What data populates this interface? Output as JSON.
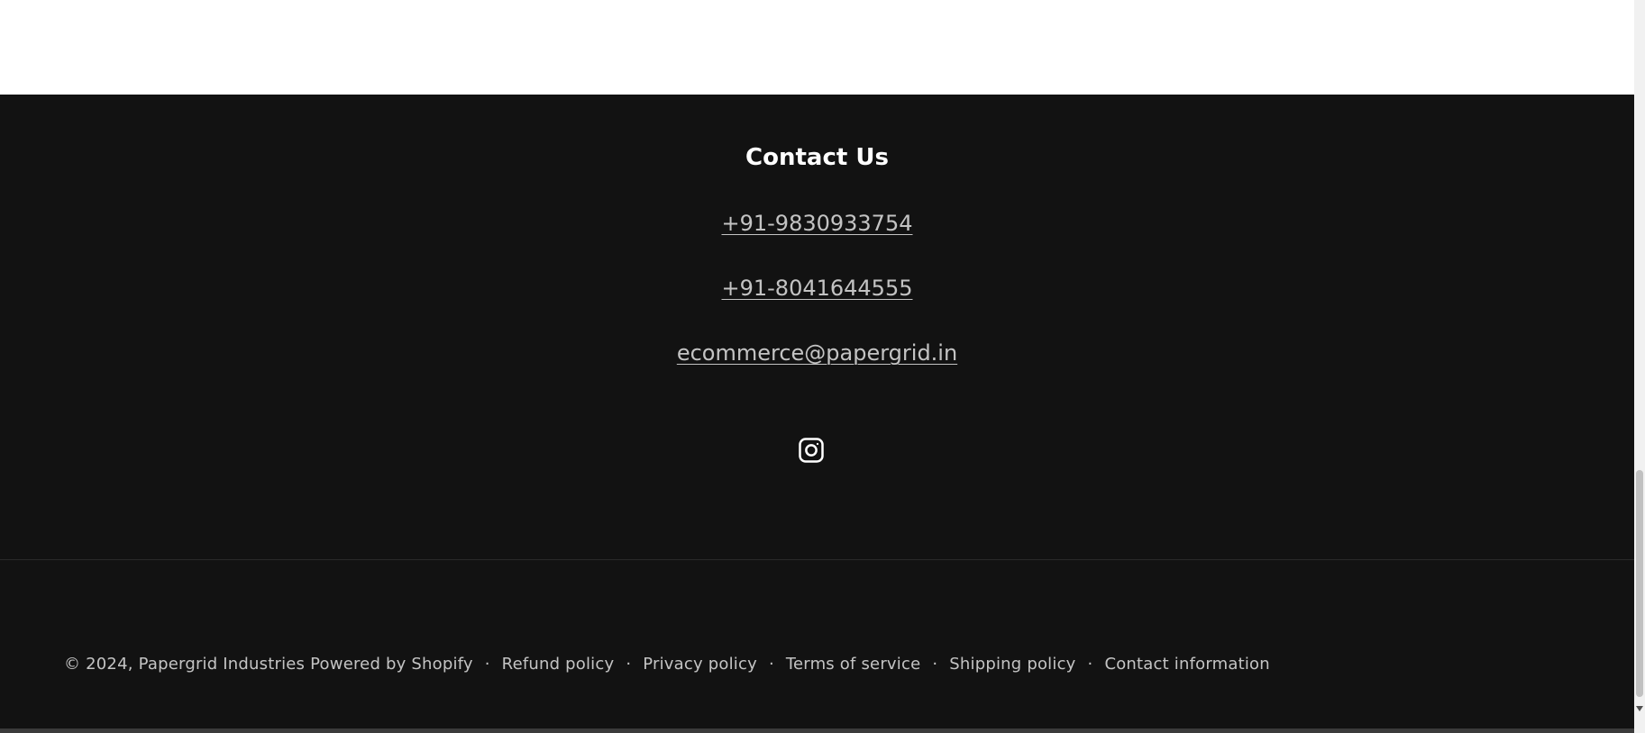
{
  "footer": {
    "contact_title": "Contact Us",
    "phone_1": "+91-9830933754",
    "phone_2": "+91-8041644555",
    "email": "ecommerce@papergrid.in",
    "social": [
      {
        "icon": "instagram-icon",
        "label": "Instagram"
      }
    ]
  },
  "bottom_bar": {
    "copyright": "© 2024,",
    "company_link": "Papergrid Industries",
    "powered_by": "Powered by Shopify",
    "separator": "·",
    "policies": [
      "Refund policy",
      "Privacy policy",
      "Terms of service",
      "Shipping policy",
      "Contact information"
    ]
  },
  "colors": {
    "footer_bg": "#121212",
    "text_primary": "#ffffff",
    "text_muted": "rgba(255,255,255,0.75)"
  }
}
